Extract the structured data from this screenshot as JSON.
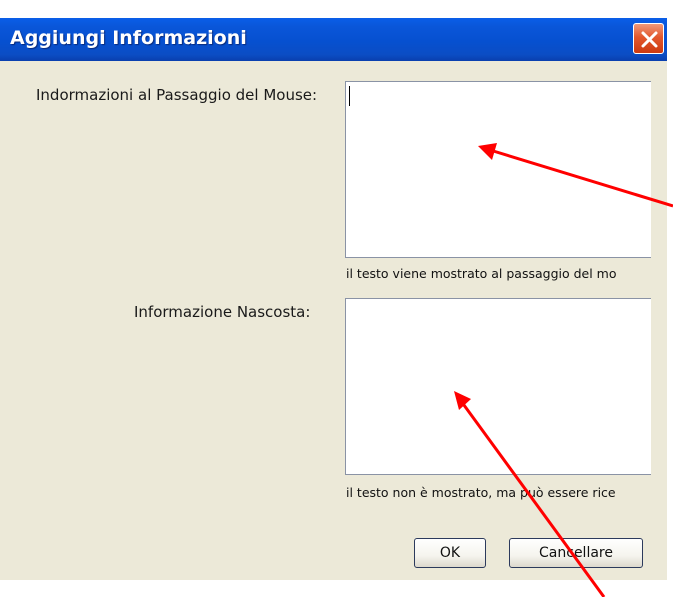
{
  "window": {
    "title": "Aggiungi Informazioni"
  },
  "fields": [
    {
      "label": "Indormazioni al Passaggio del Mouse:",
      "value": "",
      "hint": "il testo viene mostrato al passaggio del mo"
    },
    {
      "label": "Informazione Nascosta:",
      "value": "",
      "hint": "il testo non è mostrato, ma può essere rice"
    }
  ],
  "buttons": {
    "ok_label": "OK",
    "cancel_label": "Cancellare"
  },
  "colors": {
    "titlebar": "#0650D0",
    "dialog_background": "#ECE9D8",
    "close_button": "#E3582E",
    "annotation_arrow": "#FF0000"
  },
  "icons": {
    "close": "close-icon"
  }
}
